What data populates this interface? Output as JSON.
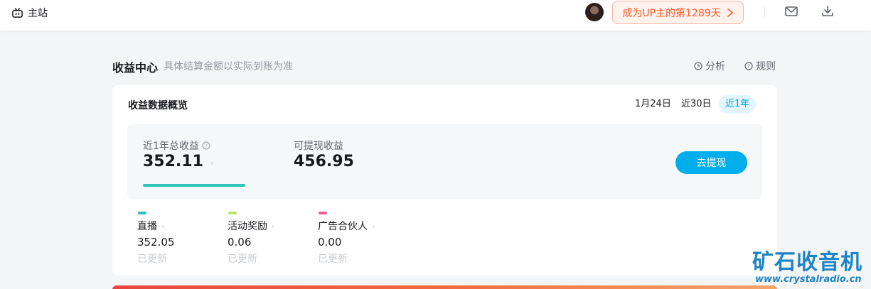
{
  "topbar": {
    "home_label": "主站",
    "up_badge": "成为UP主的第1289天",
    "icons": [
      "tv-icon",
      "avatar",
      "chevron-right-icon",
      "mail-icon",
      "download-icon"
    ]
  },
  "header": {
    "title": "收益中心",
    "note": "具体结算金额以实际到账为准",
    "analysis_label": "分析",
    "rules_label": "规则"
  },
  "overview": {
    "title": "收益数据概览",
    "ranges": [
      "1月24日",
      "近30日",
      "近1年"
    ],
    "active_range": "近1年",
    "total_label": "近1年总收益",
    "total_value": "352.11",
    "withdrawable_label": "可提现收益",
    "withdrawable_value": "456.95",
    "withdraw_button": "去提现",
    "bar_fill_fraction": 1.0,
    "accent_color": "#00aeec"
  },
  "sources": [
    {
      "name": "直播",
      "value": "352.05",
      "status": "已更新",
      "color": "#2dc2b8"
    },
    {
      "name": "活动奖励",
      "value": "0.06",
      "status": "已更新",
      "color": "#b8e563"
    },
    {
      "name": "广告合伙人",
      "value": "0.00",
      "status": "已更新",
      "color": "#f25d8e"
    }
  ],
  "watermark": {
    "cn": "矿石收音机",
    "url": "www.crystalradio.cn"
  }
}
